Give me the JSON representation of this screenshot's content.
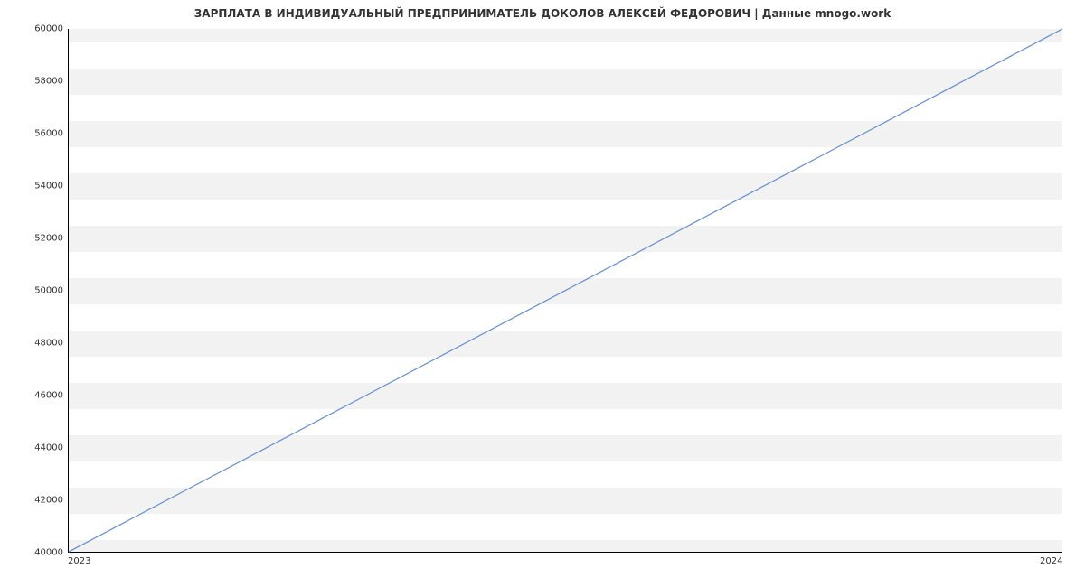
{
  "chart_data": {
    "type": "line",
    "title": "ЗАРПЛАТА В ИНДИВИДУАЛЬНЫЙ ПРЕДПРИНИМАТЕЛЬ ДОКОЛОВ АЛЕКСЕЙ ФЕДОРОВИЧ | Данные mnogo.work",
    "x": [
      2023,
      2024
    ],
    "values": [
      40000,
      60000
    ],
    "xticks": [
      "2023",
      "2024"
    ],
    "yticks": [
      "40000",
      "42000",
      "44000",
      "46000",
      "48000",
      "50000",
      "52000",
      "54000",
      "56000",
      "58000",
      "60000"
    ],
    "ylim": [
      40000,
      60000
    ],
    "xlim": [
      2023,
      2024
    ],
    "line_color": "#6f95d2"
  }
}
